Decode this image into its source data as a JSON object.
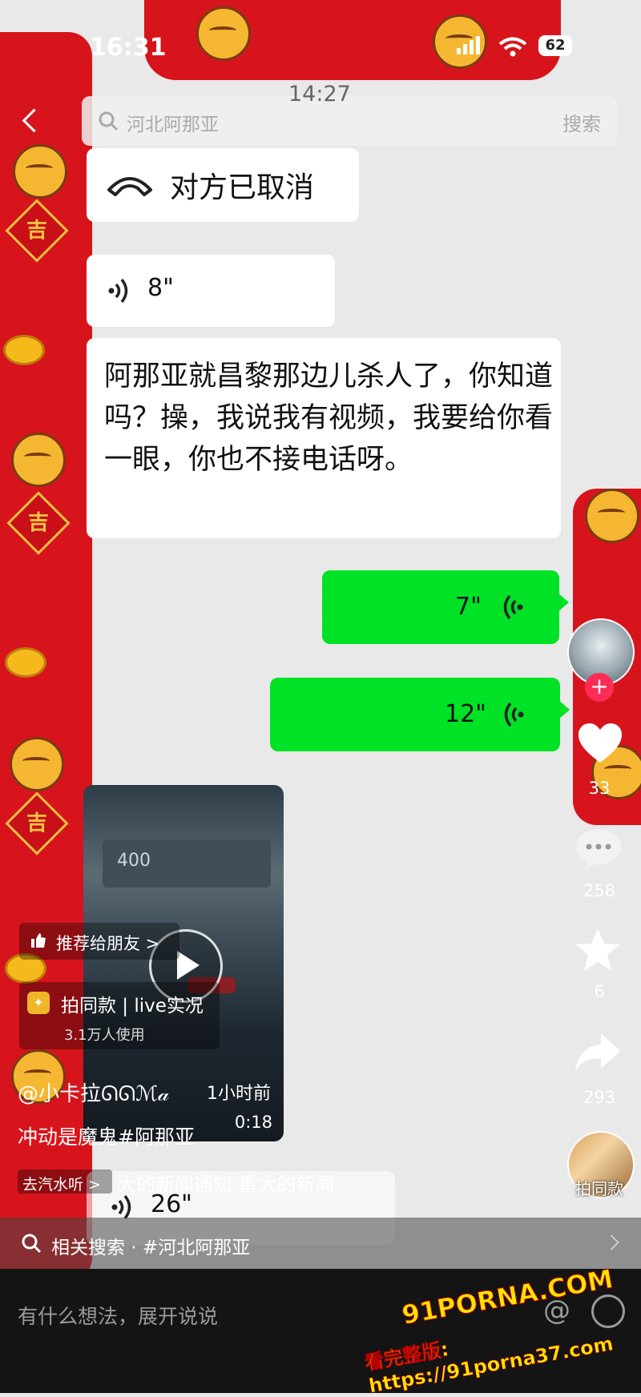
{
  "status_bar": {
    "time": "16:31",
    "battery": "62"
  },
  "chat": {
    "timestamp": "14:27",
    "messages": [
      {
        "text": "对方已取消"
      },
      {
        "text": "8\""
      },
      {
        "text": "阿那亚就昌黎那边儿杀人了，你知道吗？操，我说我有视频，我要给你看一眼，你也不接电话呀。"
      },
      {
        "text": "7\""
      },
      {
        "text": "12\""
      },
      {
        "text": "26\""
      }
    ]
  },
  "search": {
    "placeholder": "河北阿那亚",
    "button": "搜索"
  },
  "video": {
    "sign": "400",
    "duration": "0:18"
  },
  "overlay": {
    "recommend": "推荐给朋友 >",
    "same_style_title": "拍同款 | live实况",
    "same_style_users": "3.1万人使用",
    "author": "@小卡拉ᘏᘏℳ𝒶",
    "posted": "1小时前",
    "caption": "冲动是魔鬼#阿那亚",
    "qishui": "去汽水听 >",
    "news": "大的新闻通知  重大的新闻"
  },
  "rail": {
    "likes": "33",
    "comments": "258",
    "favorites": "6",
    "shares": "293",
    "same_style": "拍同款"
  },
  "related": {
    "text": "相关搜索 · #河北阿那亚"
  },
  "comment_bar": {
    "placeholder": "有什么想法，展开说说"
  },
  "watermark": {
    "line1": "91PORNA.COM",
    "line2": "看完整版: https://91porna37.com"
  },
  "colors": {
    "accent_red": "#d7141c",
    "bubble_green": "#00e226",
    "follow_pink": "#fe2c55"
  }
}
